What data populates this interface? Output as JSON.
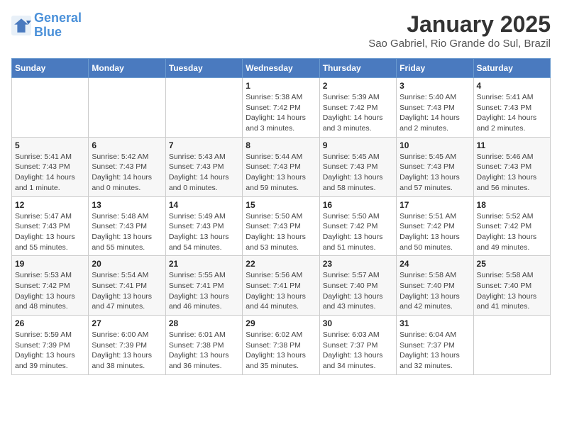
{
  "header": {
    "logo_line1": "General",
    "logo_line2": "Blue",
    "title": "January 2025",
    "subtitle": "Sao Gabriel, Rio Grande do Sul, Brazil"
  },
  "weekdays": [
    "Sunday",
    "Monday",
    "Tuesday",
    "Wednesday",
    "Thursday",
    "Friday",
    "Saturday"
  ],
  "weeks": [
    [
      {
        "day": "",
        "info": ""
      },
      {
        "day": "",
        "info": ""
      },
      {
        "day": "",
        "info": ""
      },
      {
        "day": "1",
        "info": "Sunrise: 5:38 AM\nSunset: 7:42 PM\nDaylight: 14 hours and 3 minutes."
      },
      {
        "day": "2",
        "info": "Sunrise: 5:39 AM\nSunset: 7:42 PM\nDaylight: 14 hours and 3 minutes."
      },
      {
        "day": "3",
        "info": "Sunrise: 5:40 AM\nSunset: 7:43 PM\nDaylight: 14 hours and 2 minutes."
      },
      {
        "day": "4",
        "info": "Sunrise: 5:41 AM\nSunset: 7:43 PM\nDaylight: 14 hours and 2 minutes."
      }
    ],
    [
      {
        "day": "5",
        "info": "Sunrise: 5:41 AM\nSunset: 7:43 PM\nDaylight: 14 hours and 1 minute."
      },
      {
        "day": "6",
        "info": "Sunrise: 5:42 AM\nSunset: 7:43 PM\nDaylight: 14 hours and 0 minutes."
      },
      {
        "day": "7",
        "info": "Sunrise: 5:43 AM\nSunset: 7:43 PM\nDaylight: 14 hours and 0 minutes."
      },
      {
        "day": "8",
        "info": "Sunrise: 5:44 AM\nSunset: 7:43 PM\nDaylight: 13 hours and 59 minutes."
      },
      {
        "day": "9",
        "info": "Sunrise: 5:45 AM\nSunset: 7:43 PM\nDaylight: 13 hours and 58 minutes."
      },
      {
        "day": "10",
        "info": "Sunrise: 5:45 AM\nSunset: 7:43 PM\nDaylight: 13 hours and 57 minutes."
      },
      {
        "day": "11",
        "info": "Sunrise: 5:46 AM\nSunset: 7:43 PM\nDaylight: 13 hours and 56 minutes."
      }
    ],
    [
      {
        "day": "12",
        "info": "Sunrise: 5:47 AM\nSunset: 7:43 PM\nDaylight: 13 hours and 55 minutes."
      },
      {
        "day": "13",
        "info": "Sunrise: 5:48 AM\nSunset: 7:43 PM\nDaylight: 13 hours and 55 minutes."
      },
      {
        "day": "14",
        "info": "Sunrise: 5:49 AM\nSunset: 7:43 PM\nDaylight: 13 hours and 54 minutes."
      },
      {
        "day": "15",
        "info": "Sunrise: 5:50 AM\nSunset: 7:43 PM\nDaylight: 13 hours and 53 minutes."
      },
      {
        "day": "16",
        "info": "Sunrise: 5:50 AM\nSunset: 7:42 PM\nDaylight: 13 hours and 51 minutes."
      },
      {
        "day": "17",
        "info": "Sunrise: 5:51 AM\nSunset: 7:42 PM\nDaylight: 13 hours and 50 minutes."
      },
      {
        "day": "18",
        "info": "Sunrise: 5:52 AM\nSunset: 7:42 PM\nDaylight: 13 hours and 49 minutes."
      }
    ],
    [
      {
        "day": "19",
        "info": "Sunrise: 5:53 AM\nSunset: 7:42 PM\nDaylight: 13 hours and 48 minutes."
      },
      {
        "day": "20",
        "info": "Sunrise: 5:54 AM\nSunset: 7:41 PM\nDaylight: 13 hours and 47 minutes."
      },
      {
        "day": "21",
        "info": "Sunrise: 5:55 AM\nSunset: 7:41 PM\nDaylight: 13 hours and 46 minutes."
      },
      {
        "day": "22",
        "info": "Sunrise: 5:56 AM\nSunset: 7:41 PM\nDaylight: 13 hours and 44 minutes."
      },
      {
        "day": "23",
        "info": "Sunrise: 5:57 AM\nSunset: 7:40 PM\nDaylight: 13 hours and 43 minutes."
      },
      {
        "day": "24",
        "info": "Sunrise: 5:58 AM\nSunset: 7:40 PM\nDaylight: 13 hours and 42 minutes."
      },
      {
        "day": "25",
        "info": "Sunrise: 5:58 AM\nSunset: 7:40 PM\nDaylight: 13 hours and 41 minutes."
      }
    ],
    [
      {
        "day": "26",
        "info": "Sunrise: 5:59 AM\nSunset: 7:39 PM\nDaylight: 13 hours and 39 minutes."
      },
      {
        "day": "27",
        "info": "Sunrise: 6:00 AM\nSunset: 7:39 PM\nDaylight: 13 hours and 38 minutes."
      },
      {
        "day": "28",
        "info": "Sunrise: 6:01 AM\nSunset: 7:38 PM\nDaylight: 13 hours and 36 minutes."
      },
      {
        "day": "29",
        "info": "Sunrise: 6:02 AM\nSunset: 7:38 PM\nDaylight: 13 hours and 35 minutes."
      },
      {
        "day": "30",
        "info": "Sunrise: 6:03 AM\nSunset: 7:37 PM\nDaylight: 13 hours and 34 minutes."
      },
      {
        "day": "31",
        "info": "Sunrise: 6:04 AM\nSunset: 7:37 PM\nDaylight: 13 hours and 32 minutes."
      },
      {
        "day": "",
        "info": ""
      }
    ]
  ]
}
